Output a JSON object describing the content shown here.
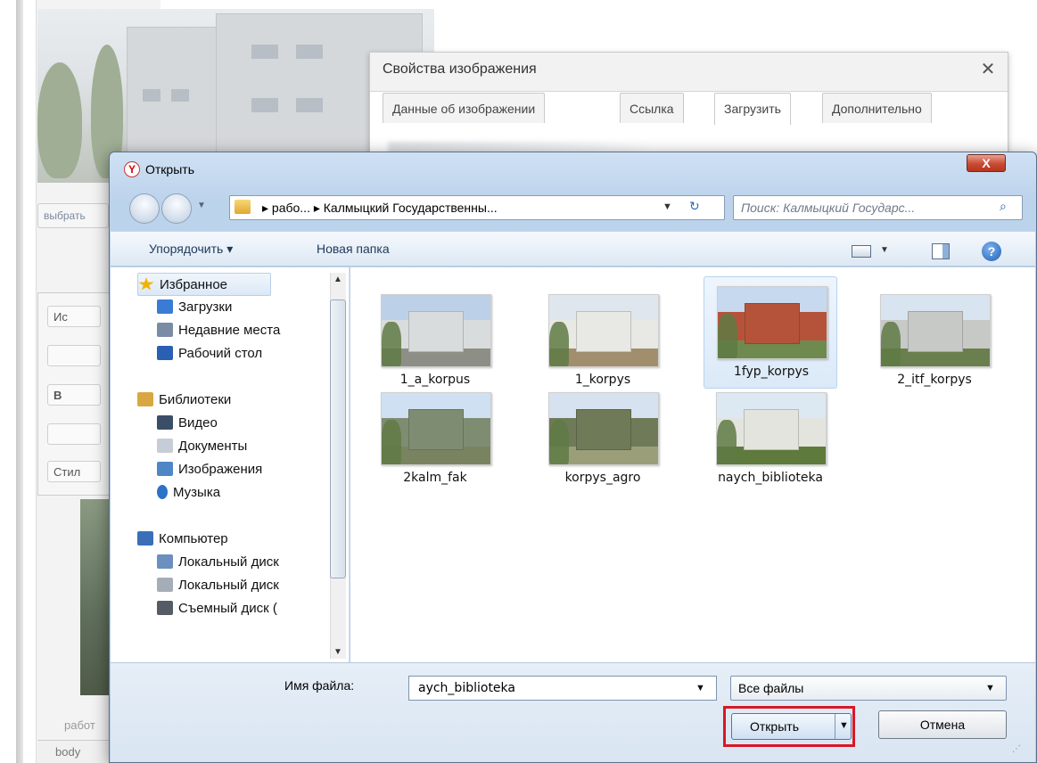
{
  "background": {
    "pick_button": "выбрать",
    "toolbar_buttons": [
      "Ис",
      "",
      "B",
      "",
      "Стил"
    ],
    "caption": "работ",
    "status_bar": "body"
  },
  "image_properties": {
    "title": "Свойства изображения",
    "close_glyph": "✕",
    "tabs": [
      {
        "label": "Данные об изображении",
        "active": false
      },
      {
        "label": "Ссылка",
        "active": false
      },
      {
        "label": "Загрузить",
        "active": true
      },
      {
        "label": "Дополнительно",
        "active": false
      }
    ]
  },
  "open_dialog": {
    "app_icon": "Y",
    "title": "Открыть",
    "close_glyph": "X",
    "address_path": "▸ рабо... ▸ Калмыцкий Государственны...",
    "search_placeholder": "Поиск: Калмыцкий Государс...",
    "commands": {
      "organize": "Упорядочить ▾",
      "new_folder": "Новая папка"
    },
    "nav_tree": [
      {
        "label": "Избранное",
        "icon": "star-icon",
        "color": "#f0b400",
        "level": 0,
        "selected": true
      },
      {
        "label": "Загрузки",
        "icon": "downloads-folder-icon",
        "color": "#3a7bd5",
        "level": 1,
        "selected": false
      },
      {
        "label": "Недавние места",
        "icon": "recent-places-icon",
        "color": "#7a8ca3",
        "level": 1,
        "selected": false
      },
      {
        "label": "Рабочий стол",
        "icon": "desktop-icon",
        "color": "#2b5fb4",
        "level": 1,
        "selected": false
      },
      {
        "label": "Библиотеки",
        "icon": "libraries-icon",
        "color": "#d9a742",
        "level": 0,
        "selected": false
      },
      {
        "label": "Видео",
        "icon": "video-icon",
        "color": "#3b4e68",
        "level": 1,
        "selected": false
      },
      {
        "label": "Документы",
        "icon": "documents-icon",
        "color": "#c7cdd6",
        "level": 1,
        "selected": false
      },
      {
        "label": "Изображения",
        "icon": "pictures-icon",
        "color": "#4f86c6",
        "level": 1,
        "selected": false
      },
      {
        "label": "Музыка",
        "icon": "music-icon",
        "color": "#2d72c9",
        "level": 1,
        "selected": false
      },
      {
        "label": "Компьютер",
        "icon": "computer-icon",
        "color": "#3a6fb8",
        "level": 0,
        "selected": false
      },
      {
        "label": "Локальный диск",
        "icon": "local-disk-icon",
        "color": "#6b8fbf",
        "level": 1,
        "selected": false
      },
      {
        "label": "Локальный диск",
        "icon": "local-disk-icon",
        "color": "#a5adb8",
        "level": 1,
        "selected": false
      },
      {
        "label": "Съемный диск (",
        "icon": "removable-disk-icon",
        "color": "#555c66",
        "level": 1,
        "selected": false
      }
    ],
    "files": [
      {
        "name": "1_a_korpus",
        "selected": false,
        "sky": "#bcd0e8",
        "ground": "#8d8f86",
        "building": "#d9dcdc"
      },
      {
        "name": "1_korpys",
        "selected": false,
        "sky": "#dfe6ee",
        "ground": "#a08e6c",
        "building": "#e8e8e4"
      },
      {
        "name": "1fyp_korpys",
        "selected": true,
        "sky": "#c6d9ef",
        "ground": "#6f8a4f",
        "building": "#b5533a"
      },
      {
        "name": "2_itf_korpys",
        "selected": false,
        "sky": "#d8e4ef",
        "ground": "#6a7f4e",
        "building": "#c7c9c7"
      },
      {
        "name": "2kalm_fak",
        "selected": false,
        "sky": "#cfe0f2",
        "ground": "#7a8360",
        "building": "#7e8d72"
      },
      {
        "name": "korpys_agro",
        "selected": false,
        "sky": "#d6e2ef",
        "ground": "#9a9f7a",
        "building": "#6f7a58"
      },
      {
        "name": "naych_biblioteka",
        "selected": false,
        "sky": "#dce8f2",
        "ground": "#5e7a3c",
        "building": "#e4e4df"
      }
    ],
    "filename_label": "Имя файла:",
    "filename_value": "aych_biblioteka",
    "filetype_value": "Все файлы",
    "open_button": "Открыть",
    "cancel_button": "Отмена"
  }
}
